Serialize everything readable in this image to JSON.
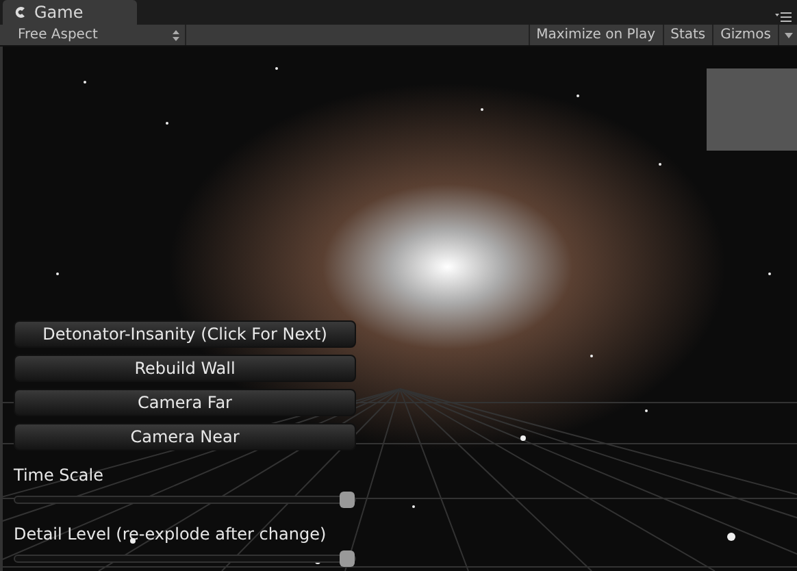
{
  "tabs": [
    {
      "label": "Game",
      "selected": true
    }
  ],
  "toolbar": {
    "aspect": "Free Aspect",
    "toggles": [
      {
        "label": "Maximize on Play",
        "on": false
      },
      {
        "label": "Stats",
        "on": false
      },
      {
        "label": "Gizmos",
        "on": false
      }
    ]
  },
  "buttons": [
    "Detonator-Insanity (Click For Next)",
    "Rebuild Wall",
    "Camera Far",
    "Camera Near"
  ],
  "sliders": [
    {
      "label": "Time Scale",
      "level": 1
    },
    {
      "label": "Detail Level (re-explode after change)",
      "level": 1
    }
  ]
}
